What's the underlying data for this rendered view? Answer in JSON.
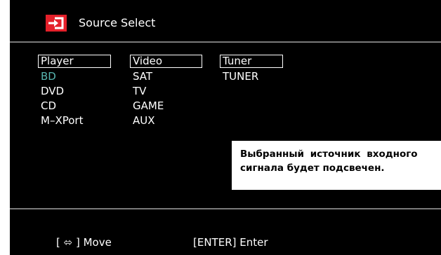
{
  "title": {
    "icon": "source-input-icon",
    "text": "Source Select"
  },
  "columns": [
    {
      "header": "Player",
      "items": [
        "BD",
        "DVD",
        "CD",
        "M–XPort"
      ]
    },
    {
      "header": "Video",
      "items": [
        "SAT",
        "TV",
        "GAME",
        "AUX"
      ]
    },
    {
      "header": "Tuner",
      "items": [
        "TUNER"
      ]
    }
  ],
  "selected": "BD",
  "info_box": {
    "line1": "Выбранный источник входного",
    "line2": "сигнала будет подсвечен."
  },
  "footer": {
    "move": "[ ⬄ ] Move",
    "enter": "[ENTER] Enter"
  },
  "colors": {
    "screen_bg": "#000000",
    "text": "#ffffff",
    "selected_text": "#57b6b0",
    "icon_red": "#e4202a",
    "divider": "#7a7a7a",
    "info_bg": "#ffffff"
  }
}
